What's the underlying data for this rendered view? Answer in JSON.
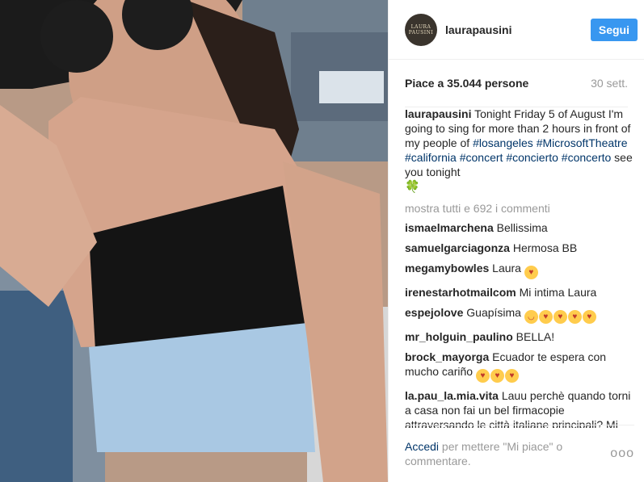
{
  "header": {
    "avatar_lines": [
      "LAURA",
      "PAUSINI"
    ],
    "username": "laurapausini",
    "follow_label": "Segui"
  },
  "meta": {
    "likes": "Piace a 35.044 persone",
    "date": "30 sett."
  },
  "caption": {
    "user": "laurapausini",
    "text1": " Tonight Friday 5 of August I'm going to sing for more than 2 hours in front of my people of ",
    "tag1": "#losangeles",
    "space1": " ",
    "tag2": "#MicrosoftTheatre",
    "space2": " ",
    "tag3": "#california",
    "space3": " ",
    "tag4": "#concert",
    "space4": " ",
    "tag5": "#concierto",
    "space5": " ",
    "tag6": "#concerto",
    "text2": " see you tonight",
    "emoji": "🍀"
  },
  "load_more": "mostra tutti e 692 i commenti",
  "comments": [
    {
      "user": "ismaelmarchena",
      "text": " Bellissima"
    },
    {
      "user": "samuelgarciagonza",
      "text": " Hermosa BB"
    },
    {
      "user": "megamybowles",
      "text": " Laura "
    },
    {
      "user": "irenestarhotmailcom",
      "text": " Mi intima Laura"
    },
    {
      "user": "espejolove",
      "text": " Guapísima "
    },
    {
      "user": "mr_holguin_paulino",
      "text": " BELLA!"
    },
    {
      "user": "brock_mayorga",
      "text": " Ecuador te espera con mucho cariño "
    },
    {
      "user": "la.pau_la.mia.vita",
      "text": " Lauu perchè quando torni a casa non fai un bel firmacopie attraversando le città italiane principali? Mi raccomando almeno pensaci eh"
    }
  ],
  "footer": {
    "login": "Accedi",
    "rest": " per mettere \"Mi piace\" o commentare.",
    "more": "ooo"
  },
  "colors": {
    "follow": "#3897f0",
    "hashtag": "#003569",
    "muted": "#999999"
  },
  "icons": [
    "heart-eyes-emoji",
    "smile-emoji",
    "kiss-emoji",
    "four-leaf-clover-emoji",
    "more-options-icon"
  ]
}
